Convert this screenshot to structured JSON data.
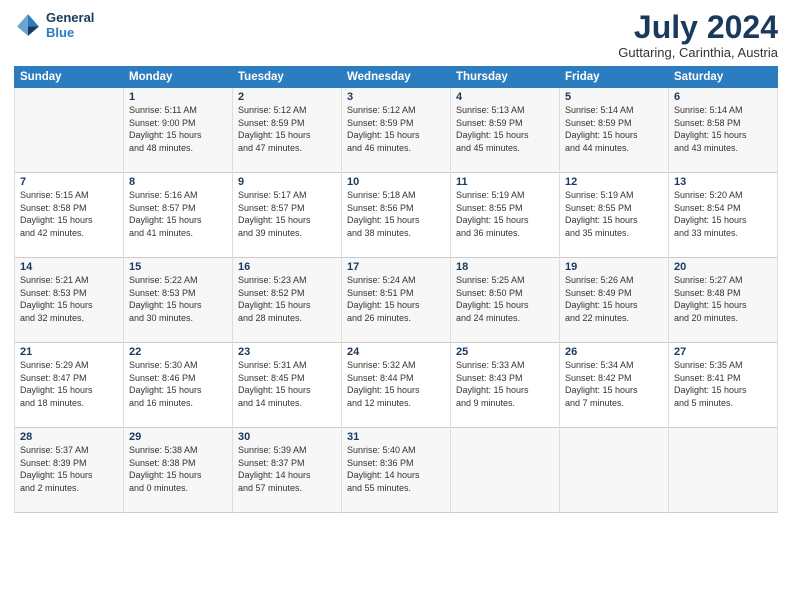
{
  "logo": {
    "line1": "General",
    "line2": "Blue"
  },
  "title": "July 2024",
  "subtitle": "Guttaring, Carinthia, Austria",
  "days_of_week": [
    "Sunday",
    "Monday",
    "Tuesday",
    "Wednesday",
    "Thursday",
    "Friday",
    "Saturday"
  ],
  "weeks": [
    [
      {
        "num": "",
        "info": ""
      },
      {
        "num": "1",
        "info": "Sunrise: 5:11 AM\nSunset: 9:00 PM\nDaylight: 15 hours\nand 48 minutes."
      },
      {
        "num": "2",
        "info": "Sunrise: 5:12 AM\nSunset: 8:59 PM\nDaylight: 15 hours\nand 47 minutes."
      },
      {
        "num": "3",
        "info": "Sunrise: 5:12 AM\nSunset: 8:59 PM\nDaylight: 15 hours\nand 46 minutes."
      },
      {
        "num": "4",
        "info": "Sunrise: 5:13 AM\nSunset: 8:59 PM\nDaylight: 15 hours\nand 45 minutes."
      },
      {
        "num": "5",
        "info": "Sunrise: 5:14 AM\nSunset: 8:59 PM\nDaylight: 15 hours\nand 44 minutes."
      },
      {
        "num": "6",
        "info": "Sunrise: 5:14 AM\nSunset: 8:58 PM\nDaylight: 15 hours\nand 43 minutes."
      }
    ],
    [
      {
        "num": "7",
        "info": "Sunrise: 5:15 AM\nSunset: 8:58 PM\nDaylight: 15 hours\nand 42 minutes."
      },
      {
        "num": "8",
        "info": "Sunrise: 5:16 AM\nSunset: 8:57 PM\nDaylight: 15 hours\nand 41 minutes."
      },
      {
        "num": "9",
        "info": "Sunrise: 5:17 AM\nSunset: 8:57 PM\nDaylight: 15 hours\nand 39 minutes."
      },
      {
        "num": "10",
        "info": "Sunrise: 5:18 AM\nSunset: 8:56 PM\nDaylight: 15 hours\nand 38 minutes."
      },
      {
        "num": "11",
        "info": "Sunrise: 5:19 AM\nSunset: 8:55 PM\nDaylight: 15 hours\nand 36 minutes."
      },
      {
        "num": "12",
        "info": "Sunrise: 5:19 AM\nSunset: 8:55 PM\nDaylight: 15 hours\nand 35 minutes."
      },
      {
        "num": "13",
        "info": "Sunrise: 5:20 AM\nSunset: 8:54 PM\nDaylight: 15 hours\nand 33 minutes."
      }
    ],
    [
      {
        "num": "14",
        "info": "Sunrise: 5:21 AM\nSunset: 8:53 PM\nDaylight: 15 hours\nand 32 minutes."
      },
      {
        "num": "15",
        "info": "Sunrise: 5:22 AM\nSunset: 8:53 PM\nDaylight: 15 hours\nand 30 minutes."
      },
      {
        "num": "16",
        "info": "Sunrise: 5:23 AM\nSunset: 8:52 PM\nDaylight: 15 hours\nand 28 minutes."
      },
      {
        "num": "17",
        "info": "Sunrise: 5:24 AM\nSunset: 8:51 PM\nDaylight: 15 hours\nand 26 minutes."
      },
      {
        "num": "18",
        "info": "Sunrise: 5:25 AM\nSunset: 8:50 PM\nDaylight: 15 hours\nand 24 minutes."
      },
      {
        "num": "19",
        "info": "Sunrise: 5:26 AM\nSunset: 8:49 PM\nDaylight: 15 hours\nand 22 minutes."
      },
      {
        "num": "20",
        "info": "Sunrise: 5:27 AM\nSunset: 8:48 PM\nDaylight: 15 hours\nand 20 minutes."
      }
    ],
    [
      {
        "num": "21",
        "info": "Sunrise: 5:29 AM\nSunset: 8:47 PM\nDaylight: 15 hours\nand 18 minutes."
      },
      {
        "num": "22",
        "info": "Sunrise: 5:30 AM\nSunset: 8:46 PM\nDaylight: 15 hours\nand 16 minutes."
      },
      {
        "num": "23",
        "info": "Sunrise: 5:31 AM\nSunset: 8:45 PM\nDaylight: 15 hours\nand 14 minutes."
      },
      {
        "num": "24",
        "info": "Sunrise: 5:32 AM\nSunset: 8:44 PM\nDaylight: 15 hours\nand 12 minutes."
      },
      {
        "num": "25",
        "info": "Sunrise: 5:33 AM\nSunset: 8:43 PM\nDaylight: 15 hours\nand 9 minutes."
      },
      {
        "num": "26",
        "info": "Sunrise: 5:34 AM\nSunset: 8:42 PM\nDaylight: 15 hours\nand 7 minutes."
      },
      {
        "num": "27",
        "info": "Sunrise: 5:35 AM\nSunset: 8:41 PM\nDaylight: 15 hours\nand 5 minutes."
      }
    ],
    [
      {
        "num": "28",
        "info": "Sunrise: 5:37 AM\nSunset: 8:39 PM\nDaylight: 15 hours\nand 2 minutes."
      },
      {
        "num": "29",
        "info": "Sunrise: 5:38 AM\nSunset: 8:38 PM\nDaylight: 15 hours\nand 0 minutes."
      },
      {
        "num": "30",
        "info": "Sunrise: 5:39 AM\nSunset: 8:37 PM\nDaylight: 14 hours\nand 57 minutes."
      },
      {
        "num": "31",
        "info": "Sunrise: 5:40 AM\nSunset: 8:36 PM\nDaylight: 14 hours\nand 55 minutes."
      },
      {
        "num": "",
        "info": ""
      },
      {
        "num": "",
        "info": ""
      },
      {
        "num": "",
        "info": ""
      }
    ]
  ]
}
